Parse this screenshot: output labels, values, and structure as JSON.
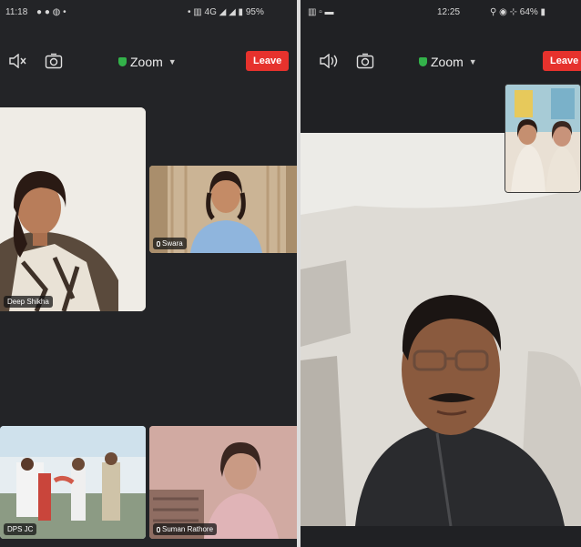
{
  "left": {
    "status": {
      "time": "11:18",
      "system": "• ▥ 4G ◢ ◢ ▮ 95%"
    },
    "toolbar": {
      "app_name": "Zoom",
      "leave_label": "Leave"
    },
    "tiles": [
      {
        "label": "Deep Shikha"
      },
      {
        "label": "Swara"
      },
      {
        "label": "DPS JC"
      },
      {
        "label": "Suman Rathore"
      }
    ]
  },
  "right": {
    "status": {
      "time": "12:25",
      "system": "⚲ ◉ ⊹ 64% ▮"
    },
    "toolbar": {
      "app_name": "Zoom",
      "leave_label": "Leave"
    }
  },
  "colors": {
    "leave": "#e6322d",
    "shield": "#33b24a",
    "background": "#232427"
  },
  "icons": [
    "speaker-icon",
    "camera-switch-icon",
    "shield-icon",
    "chevron-down-icon",
    "microphone-icon"
  ]
}
